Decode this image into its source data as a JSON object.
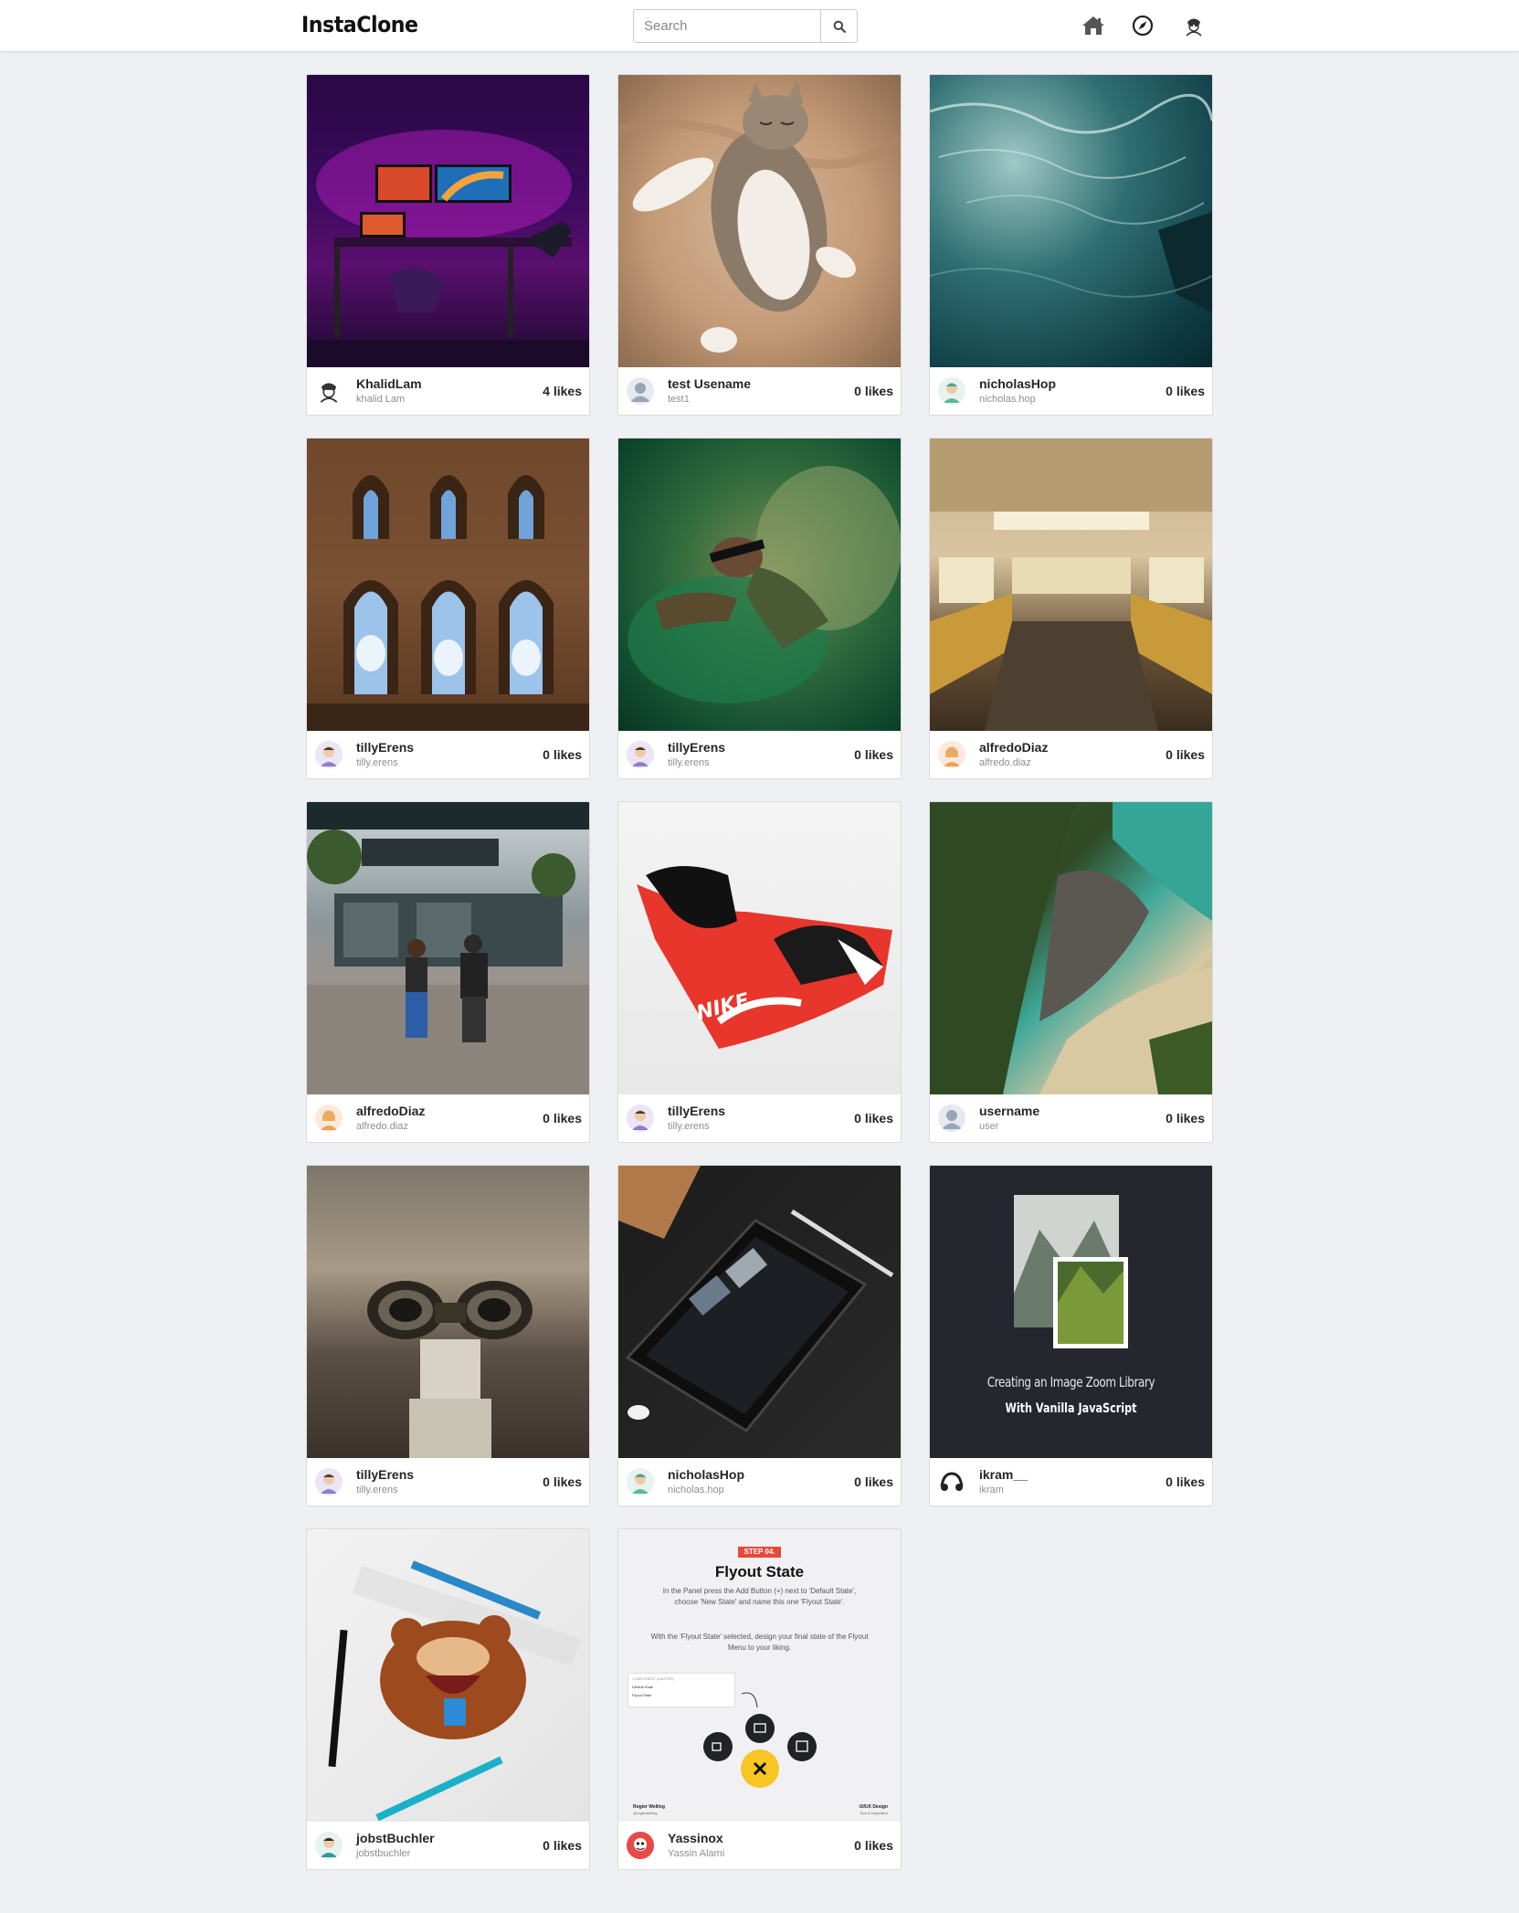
{
  "app": {
    "logo": "InstaClone"
  },
  "search": {
    "placeholder": "Search"
  },
  "posts": [
    {
      "username": "KhalidLam",
      "fullname": "khalid Lam",
      "likes": "4 likes"
    },
    {
      "username": "test Usename",
      "fullname": "test1",
      "likes": "0 likes"
    },
    {
      "username": "nicholasHop",
      "fullname": "nicholas.hop",
      "likes": "0 likes"
    },
    {
      "username": "tillyErens",
      "fullname": "tilly.erens",
      "likes": "0 likes"
    },
    {
      "username": "tillyErens",
      "fullname": "tilly.erens",
      "likes": "0 likes"
    },
    {
      "username": "alfredoDiaz",
      "fullname": "alfredo.diaz",
      "likes": "0 likes"
    },
    {
      "username": "alfredoDiaz",
      "fullname": "alfredo.diaz",
      "likes": "0 likes"
    },
    {
      "username": "tillyErens",
      "fullname": "tilly.erens",
      "likes": "0 likes"
    },
    {
      "username": "username",
      "fullname": "user",
      "likes": "0 likes"
    },
    {
      "username": "tillyErens",
      "fullname": "tilly.erens",
      "likes": "0 likes"
    },
    {
      "username": "nicholasHop",
      "fullname": "nicholas.hop",
      "likes": "0 likes"
    },
    {
      "username": "ikram__",
      "fullname": "ikram",
      "likes": "0 likes"
    },
    {
      "username": "jobstBuchler",
      "fullname": "jobstbuchler",
      "likes": "0 likes"
    },
    {
      "username": "Yassinox",
      "fullname": "Yassin Alami",
      "likes": "0 likes"
    }
  ],
  "photo_text": {
    "zoom_title": "Creating an Image Zoom Library",
    "zoom_subtitle": "With Vanilla JavaScript",
    "flyout_step": "STEP 04.",
    "flyout_title": "Flyout State",
    "flyout_p1": "In the Panel press the Add Button (+) next to 'Default State', choose 'New State' and name this one 'Flyout State'.",
    "flyout_p2": "With the 'Flyout State' selected, design your final state of the Flyout Menu to your liking.",
    "flyout_panel_head": "COMPONENT (MASTER)",
    "flyout_panel_item1": "Default State",
    "flyout_panel_item2": "Flyout State",
    "flyout_footer_left": "Rogier Welling",
    "flyout_footer_left2": "@rogierwelling",
    "flyout_footer_right": "UI/UX Design",
    "flyout_footer_right2": "Tips & Inspiration",
    "shoe_brand": "NIKE"
  }
}
